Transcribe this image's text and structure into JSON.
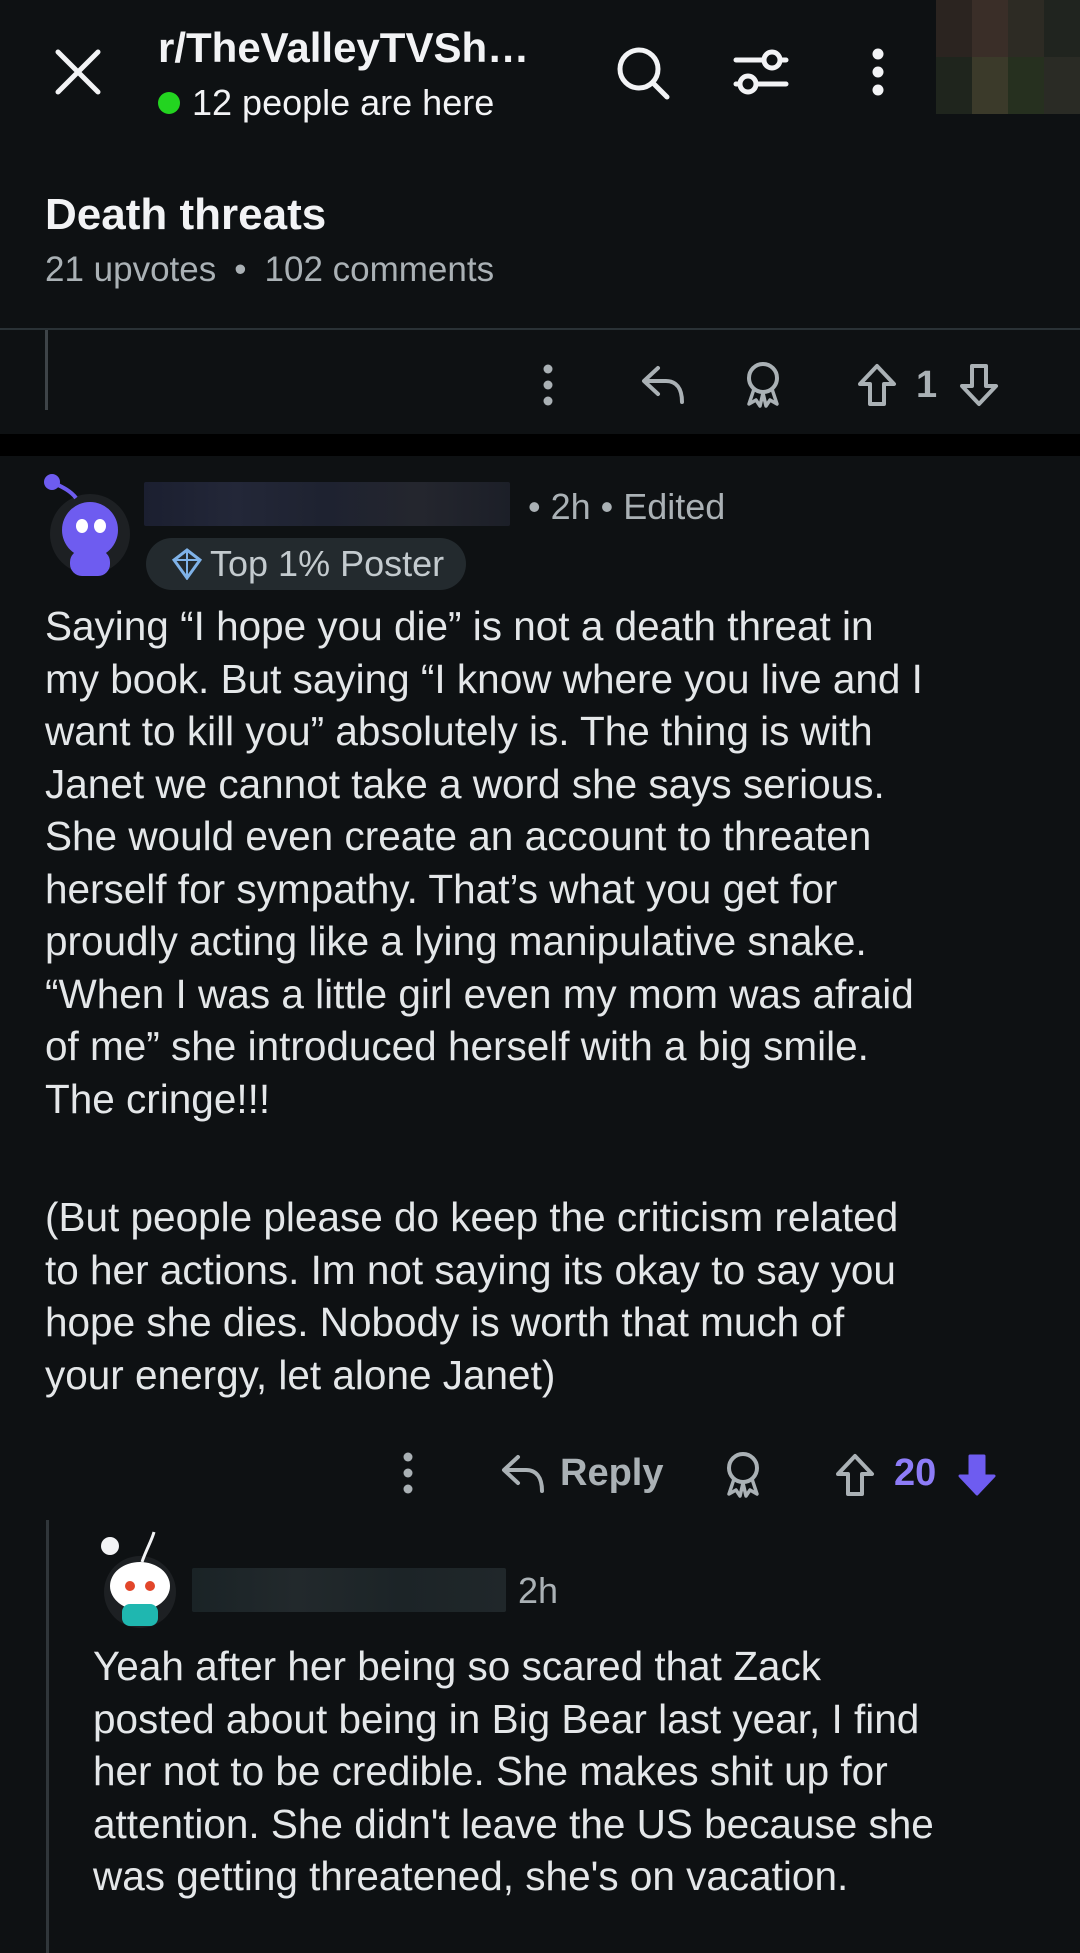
{
  "header": {
    "subreddit": "r/TheValleyTVSh…",
    "online": "12 people are here",
    "colors": {
      "online_dot": "#23d420",
      "background": "#0e1113"
    }
  },
  "post": {
    "title": "Death threats",
    "upvotes": "21 upvotes",
    "comments": "102 comments",
    "vote_count": "1",
    "icons": [
      "more-icon",
      "share-icon",
      "award-icon",
      "upvote-icon",
      "downvote-icon"
    ]
  },
  "comment": {
    "time": "• 2h • Edited",
    "flair": "Top 1% Poster",
    "body_p1": "Saying “I hope you die” is not a death threat in\nmy book. But saying “I know where you live and I\nwant to kill you” absolutely is. The thing is with\nJanet we cannot take a word she says serious.\nShe would even create an account to threaten\nherself for sympathy. That’s what you get for\nproudly acting like a lying manipulative snake.\n“When I was a little girl even my mom was afraid\nof me” she introduced herself with a big smile.\nThe cringe!!!",
    "body_p2": "(But people please do keep the criticism related\nto her actions. Im not saying its okay to say you\nhope she dies. Nobody is worth that much of\nyour energy, let alone Janet)",
    "reply_label": "Reply",
    "vote_count": "20",
    "vote_color": "#8d7cf7"
  },
  "reply": {
    "time": "2h",
    "body": "Yeah after her being so scared that Zack\nposted about being in Big Bear last year, I find\nher not to be credible. She makes shit up for\nattention. She didn't leave the US because she\nwas getting threatened, she's on vacation."
  }
}
